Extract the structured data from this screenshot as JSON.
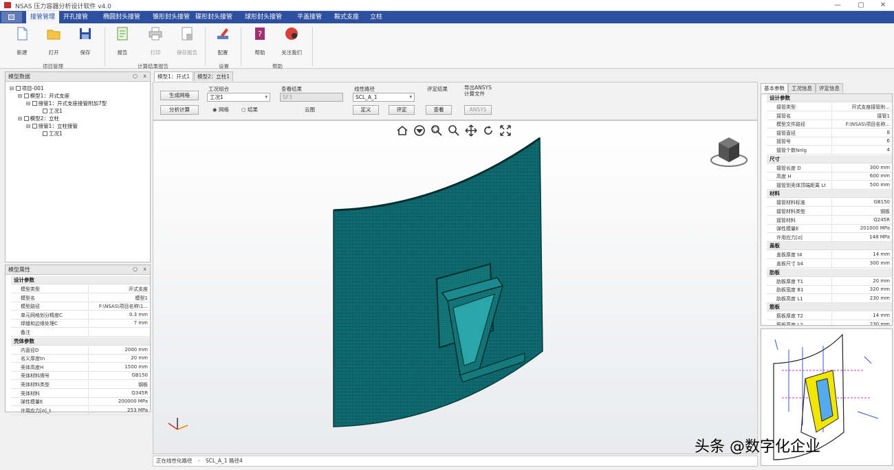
{
  "window": {
    "title": "NSAS 压力容器分析设计软件 v4.0",
    "controls": [
      "—",
      "▢",
      "✕"
    ]
  },
  "menu": [
    "接管管理",
    "开孔接管",
    "椭圆封头接管",
    "锥形封头接管",
    "碟形封头接管",
    "球形封头接管",
    "平盖接管",
    "鞍式支座",
    "立柱"
  ],
  "ribbon": {
    "buttons": [
      {
        "name": "new",
        "label": "新建"
      },
      {
        "name": "open",
        "label": "打开"
      },
      {
        "name": "save",
        "label": "保存"
      },
      {
        "name": "report",
        "label": "报告"
      },
      {
        "name": "print",
        "label": "打印"
      },
      {
        "name": "save-report",
        "label": "保存报告"
      },
      {
        "name": "config",
        "label": "配置"
      },
      {
        "name": "help",
        "label": "帮助"
      },
      {
        "name": "about",
        "label": "关注我们"
      }
    ],
    "groups": [
      "项目管理",
      "计算结果报告",
      "设置",
      "帮助"
    ]
  },
  "tree_panel": {
    "title": "模型数据",
    "items": [
      "项目-001",
      "模型1：开式支座",
      "接管1：开式支座接管附加7型",
      "工况1",
      "模型2：立柱",
      "接管1：立柱接管",
      "工况1"
    ]
  },
  "props_panel": {
    "title": "模型属性",
    "sections": [
      {
        "name": "设计参数",
        "rows": [
          [
            "模型类型",
            "开式支座"
          ],
          [
            "模型名",
            "模型1"
          ],
          [
            "模型路径",
            "F:\\NSAS\\项目名称\\1..."
          ],
          [
            "单元网格划分精度C",
            "0.3 mm"
          ],
          [
            "焊缝和边缘处理C",
            "7 mm"
          ],
          [
            "备注",
            ""
          ]
        ]
      },
      {
        "name": "壳体参数",
        "rows": [
          [
            "内直径D",
            "2000 mm"
          ],
          [
            "名义厚度tn",
            "20 mm"
          ],
          [
            "壳体高度H",
            "1500 mm"
          ],
          [
            "壳体材料牌号",
            "GB150"
          ],
          [
            "壳体材料类型",
            "钢板"
          ],
          [
            "壳体材料",
            "Q345R"
          ],
          [
            "弹性模量E",
            "200000 MPa"
          ],
          [
            "许用应力[σ]_t",
            "253 MPa"
          ]
        ]
      }
    ]
  },
  "viewport_tabs": [
    "模型1：开式1",
    "模型2：立柱1"
  ],
  "toolbar": {
    "btn_mesh": "生成网格",
    "btn_analyze": "分析计算",
    "lbl_case": "工况组合",
    "case_value": "工况1",
    "lbl_view": "查看结果",
    "view_value": "SF3",
    "lbl_path": "线性路径",
    "path_value": "SCL_A_1",
    "lbl_eval": "评定结果",
    "lbl_ansys": "导出ANSYS\n计算文件",
    "radio_mesh": "网格",
    "radio_result": "结果",
    "cloud": "云图",
    "btn_define": "定义",
    "btn_evaluate": "评定",
    "btn_view": "查看",
    "btn_ansys": "ANSYS"
  },
  "viewport_tools": [
    "home-icon",
    "view-icon",
    "zoom-window-icon",
    "zoom-icon",
    "pan-icon",
    "rotate-icon",
    "fit-icon"
  ],
  "status": {
    "left": "正在线性化路径",
    "sep": "-",
    "right": "SCL_A_1 路径4"
  },
  "right_panel": {
    "tabs": [
      "基本参数",
      "工况信息",
      "评定信息"
    ],
    "sections": [
      {
        "name": "设计参数",
        "rows": [
          [
            "接管类型",
            "开式支座接管附..."
          ],
          [
            "接管名",
            "接管1"
          ],
          [
            "模型文件路径",
            "F:\\NSAS\\项目名称..."
          ],
          [
            "接管直径",
            "8"
          ],
          [
            "接管号",
            "6"
          ],
          [
            "接管个数Nnlg",
            "4"
          ]
        ]
      },
      {
        "name": "尺寸",
        "rows": [
          [
            "接管长度 D",
            "300 mm"
          ],
          [
            "高度 H",
            "600 mm"
          ],
          [
            "接管到壳体顶端距离 Lt",
            "500 mm"
          ]
        ]
      },
      {
        "name": "材料",
        "rows": [
          [
            "接管材料标准",
            "GB150"
          ],
          [
            "接管材料类型",
            "钢板"
          ],
          [
            "接管材料",
            "Q245R"
          ],
          [
            "弹性模量E",
            "201000 MPa"
          ],
          [
            "许用应力[σ]",
            "148 MPa"
          ]
        ]
      },
      {
        "name": "盖板",
        "rows": [
          [
            "盖板厚度 t4",
            "14 mm"
          ],
          [
            "盖板尺寸 b4",
            "300 mm"
          ]
        ]
      },
      {
        "name": "肋板",
        "rows": [
          [
            "肋板厚度 T1",
            "20 mm"
          ],
          [
            "肋板宽度 B1",
            "320 mm"
          ],
          [
            "肋板高度 L1",
            "230 mm"
          ]
        ]
      },
      {
        "name": "筋板",
        "rows": [
          [
            "筋板厚度 T2",
            "14 mm"
          ],
          [
            "筋板高度 L2",
            "230 mm"
          ]
        ]
      }
    ]
  },
  "watermark": "头条 @数字化企业",
  "colors": {
    "menubar": "#2d4fa0",
    "mesh": "#0e6a6e",
    "accent": "#c42d2d"
  }
}
